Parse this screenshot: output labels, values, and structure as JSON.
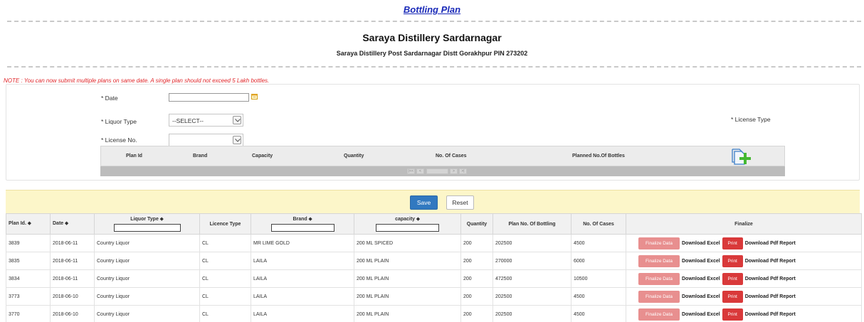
{
  "page_title": "Bottling Plan",
  "organization": {
    "name": "Saraya Distillery Sardarnagar",
    "address": "Saraya Distillery Post Sardarnagar Distt Gorakhpur PIN 273202"
  },
  "note": "NOTE : You can now submit multiple plans on same date. A single plan should not exceed 5 Lakh bottles.",
  "form": {
    "date_label": "* Date",
    "date_value": "",
    "liquor_type_label": "* Liquor Type",
    "liquor_type_value": "--SELECT--",
    "license_type_label": "* License Type",
    "license_no_label": "* License No.",
    "license_no_value": ""
  },
  "entry_grid": {
    "headers": [
      "Plan Id",
      "Brand",
      "Capacity",
      "Quantity",
      "No. Of Cases",
      "Planned No.Of Bottles"
    ],
    "pager": [
      "|<<",
      "<",
      "",
      ">",
      ">|"
    ]
  },
  "actions": {
    "save": "Save",
    "reset": "Reset"
  },
  "table": {
    "headers": {
      "plan_id": "Plan Id. ⬥",
      "date": "Date ⬥",
      "liquor_type": "Liquor Type ⬥",
      "licence_type": "Licence Type",
      "brand": "Brand ⬥",
      "capacity": "capacity ⬥",
      "quantity": "Quantity",
      "plan_no_bottling": "Plan No. Of Bottling",
      "no_of_cases": "No. Of Cases",
      "finalize": "Finalize"
    },
    "rows": [
      {
        "plan_id": "3839",
        "date": "2018-06-11",
        "liquor_type": "Country Liquor",
        "licence_type": "CL",
        "brand": "MR LIME GOLD",
        "capacity": "200 ML SPICED",
        "quantity": "200",
        "plan_no_bottling": "202500",
        "no_of_cases": "4500"
      },
      {
        "plan_id": "3835",
        "date": "2018-06-11",
        "liquor_type": "Country Liquor",
        "licence_type": "CL",
        "brand": "LAILA",
        "capacity": "200 ML PLAIN",
        "quantity": "200",
        "plan_no_bottling": "270000",
        "no_of_cases": "6000"
      },
      {
        "plan_id": "3834",
        "date": "2018-06-11",
        "liquor_type": "Country Liquor",
        "licence_type": "CL",
        "brand": "LAILA",
        "capacity": "200 ML PLAIN",
        "quantity": "200",
        "plan_no_bottling": "472500",
        "no_of_cases": "10500"
      },
      {
        "plan_id": "3773",
        "date": "2018-06-10",
        "liquor_type": "Country Liquor",
        "licence_type": "CL",
        "brand": "LAILA",
        "capacity": "200 ML PLAIN",
        "quantity": "200",
        "plan_no_bottling": "202500",
        "no_of_cases": "4500"
      },
      {
        "plan_id": "3770",
        "date": "2018-06-10",
        "liquor_type": "Country Liquor",
        "licence_type": "CL",
        "brand": "LAILA",
        "capacity": "200 ML PLAIN",
        "quantity": "200",
        "plan_no_bottling": "202500",
        "no_of_cases": "4500"
      }
    ],
    "row_actions": {
      "finalize": "Finalize Data",
      "download_excel": "Download Excel",
      "print": "Print",
      "download_pdf": "Download Pdf Report"
    }
  },
  "colors": {
    "title_blue": "#1a2ab8",
    "note_red": "#e0262a",
    "panel_yellow": "#fcf6c9",
    "save_blue": "#3179c0",
    "print_red": "#d9393a",
    "finalize_pink": "#e88f8f",
    "add_icon_green": "#44b832"
  },
  "icons": [
    "calendar-icon",
    "chevron-down-icon",
    "add-document-icon"
  ]
}
